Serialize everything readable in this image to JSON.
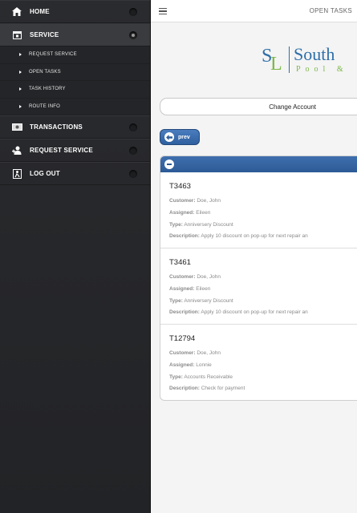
{
  "sidebar": {
    "items": [
      {
        "label": "HOME",
        "icon": "home-icon"
      },
      {
        "label": "SERVICE",
        "icon": "calendar-icon"
      },
      {
        "label": "TRANSACTIONS",
        "icon": "money-icon"
      },
      {
        "label": "REQUEST SERVICE",
        "icon": "person-add-icon"
      },
      {
        "label": "LOG OUT",
        "icon": "logout-icon"
      }
    ],
    "service_sub": [
      {
        "label": "REQUEST SERVICE"
      },
      {
        "label": "OPEN TASKS"
      },
      {
        "label": "TASK HISTORY"
      },
      {
        "label": "ROUTE INFO"
      }
    ]
  },
  "header": {
    "title": "OPEN TASKS"
  },
  "logo": {
    "mark_s": "S",
    "mark_l": "L",
    "brand": "South",
    "brand_sub": "Pool &"
  },
  "change_account": {
    "label": "Change Account"
  },
  "prev": {
    "label": "prev"
  },
  "fields": {
    "customer": "Customer:",
    "assigned": "Assigned:",
    "type": "Type:",
    "description": "Description:"
  },
  "tasks": [
    {
      "id": "T3463",
      "customer": "Doe, John",
      "assigned": "Eileen",
      "type": "Anniversery Discount",
      "description": "Apply 10 discount on pop-up for next repair an"
    },
    {
      "id": "T3461",
      "customer": "Doe, John",
      "assigned": "Eileen",
      "type": "Anniversery Discount",
      "description": "Apply 10 discount on pop-up for next repair an"
    },
    {
      "id": "T12794",
      "customer": "Doe, John",
      "assigned": "Lonnie",
      "type": "Accounts Receivable",
      "description": "Check for payment"
    }
  ]
}
